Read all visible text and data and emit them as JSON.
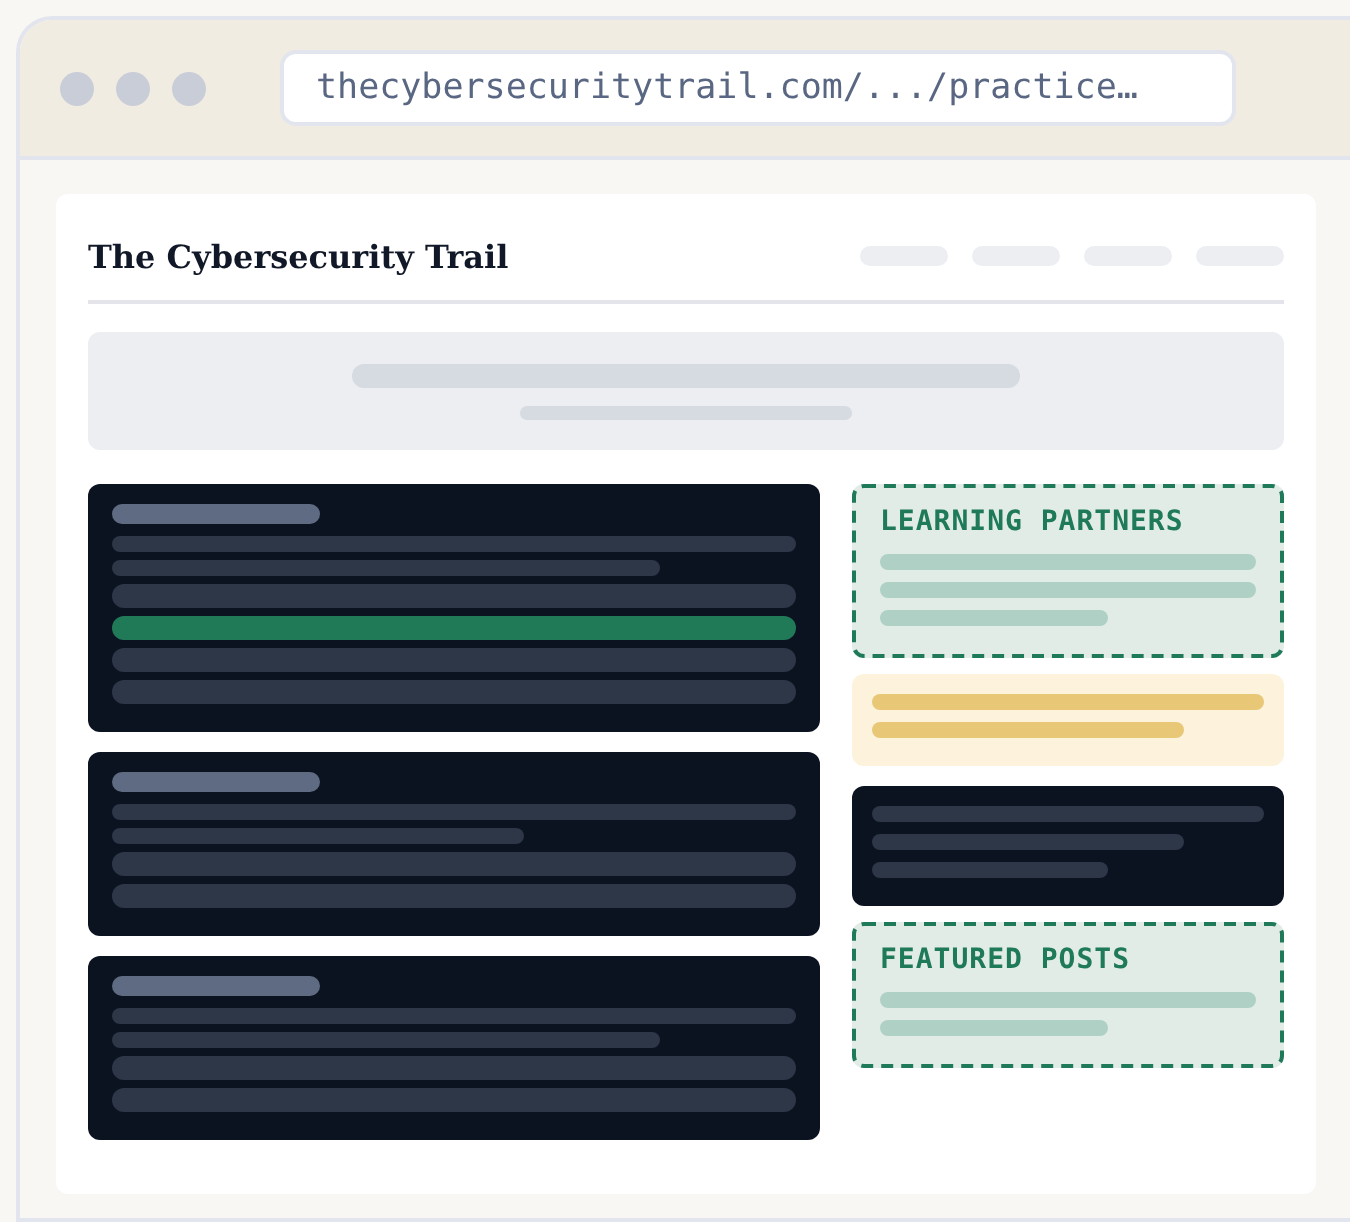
{
  "window": {
    "url": "thecybersecuritytrail.com/.../practice…"
  },
  "site": {
    "title": "The Cybersecurity Trail"
  },
  "main_cards": [
    {
      "kind": "highlighted"
    },
    {
      "kind": "plain"
    },
    {
      "kind": "plain"
    }
  ],
  "sidebar": [
    {
      "kind": "labeled",
      "title": "LEARNING PARTNERS"
    },
    {
      "kind": "note"
    },
    {
      "kind": "dark"
    },
    {
      "kind": "labeled",
      "title": "FEATURED POSTS"
    }
  ]
}
